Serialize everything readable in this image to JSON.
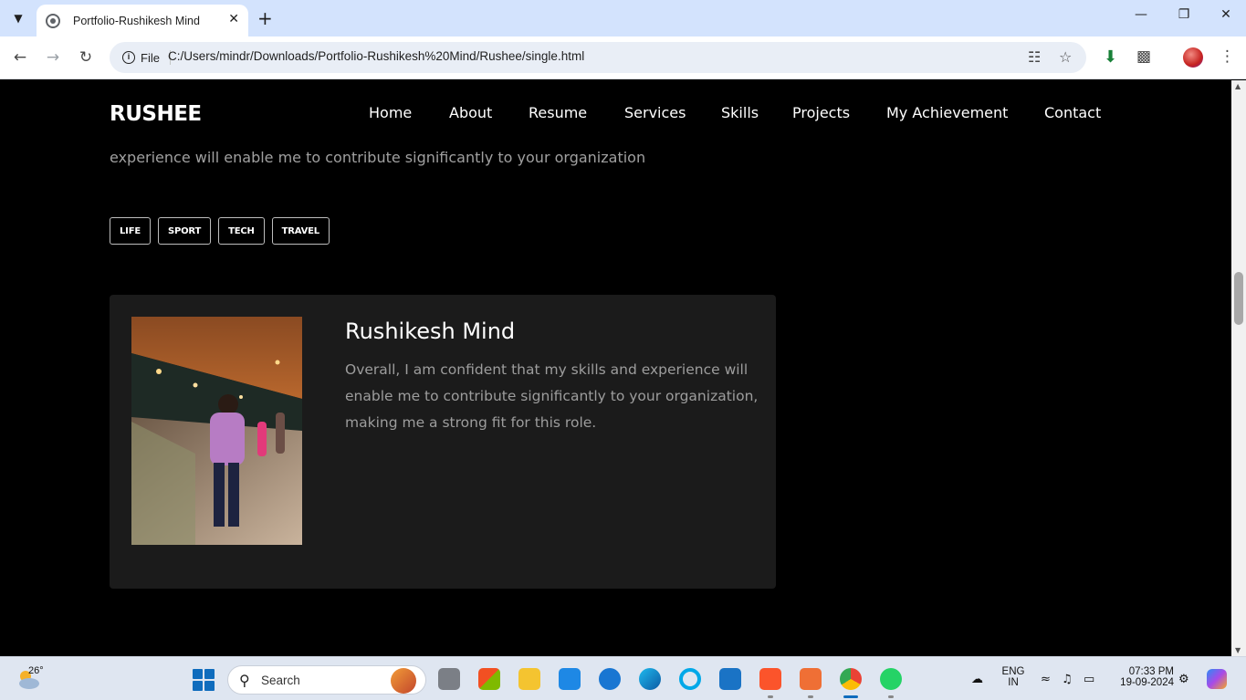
{
  "browser": {
    "tab_title": "Portfolio-Rushikesh Mind",
    "site_info_label": "File",
    "url": "C:/Users/mindr/Downloads/Portfolio-Rushikesh%20Mind/Rushee/single.html"
  },
  "site": {
    "logo": "RUSHEE",
    "nav": [
      "Home",
      "About",
      "Resume",
      "Services",
      "Skills",
      "Projects",
      "My Achievement",
      "Contact"
    ],
    "intro_text": "experience will enable me to contribute significantly to your organization",
    "tags": [
      "LIFE",
      "SPORT",
      "TECH",
      "TRAVEL"
    ],
    "author": {
      "name": "Rushikesh Mind",
      "bio": "Overall, I am confident that my skills and experience will enable me to contribute significantly to your organization, making me a strong fit for this role."
    }
  },
  "taskbar": {
    "temperature": "26°",
    "search_label": "Search",
    "language_line1": "ENG",
    "language_line2": "IN",
    "time": "07:33 PM",
    "date": "19-09-2024"
  },
  "colors": {
    "page_bg": "#000000",
    "card_bg": "#1b1b1b",
    "muted_text": "#a0a0a0",
    "tabbar_bg": "#d3e3fd"
  }
}
